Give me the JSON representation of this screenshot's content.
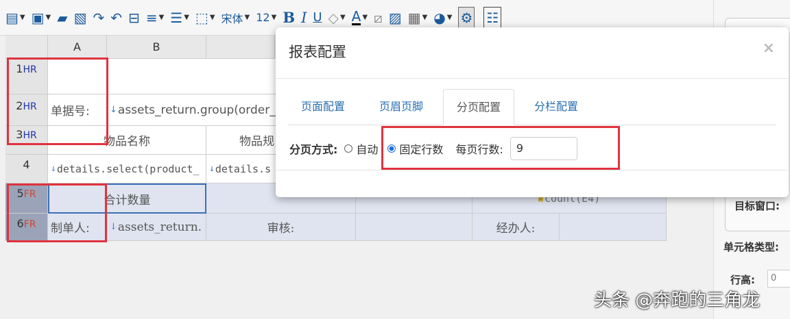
{
  "toolbar": {
    "font_name": "宋体",
    "font_size": "12",
    "bold_label": "B",
    "italic_label": "I",
    "underline_label": "U",
    "font_color_label": "A"
  },
  "sheet": {
    "columns": [
      "A",
      "B"
    ],
    "rows": [
      {
        "num": "1",
        "tag": "HR"
      },
      {
        "num": "2",
        "tag": "HR"
      },
      {
        "num": "3",
        "tag": "HR"
      },
      {
        "num": "4",
        "tag": ""
      },
      {
        "num": "5",
        "tag": "FR"
      },
      {
        "num": "6",
        "tag": "FR"
      }
    ],
    "cells": {
      "r2_label": "单据号:",
      "r2_expr": "assets_return.group(order_",
      "r3_item_name": "物品名称",
      "r3_item_spec": "物品规",
      "r4_a": "details.select(product_",
      "r4_b": "details.s",
      "r5_total": "合计数量",
      "r5_count": "count(E4)",
      "r6_maker": "制单人:",
      "r6_maker_expr": "assets_return.",
      "r6_review": "审核:",
      "r6_handler": "经办人:"
    }
  },
  "right_panel": {
    "target_window_label": "目标窗口:",
    "cell_type_label": "单元格类型:",
    "row_height_label": "行高:",
    "row_height_value": "0"
  },
  "modal": {
    "title": "报表配置",
    "close": "×",
    "tabs": [
      "页面配置",
      "页眉页脚",
      "分页配置",
      "分栏配置"
    ],
    "active_tab": "分页配置",
    "paging_mode_label": "分页方式:",
    "option_auto": "自动",
    "option_fixed": "固定行数",
    "selected_option": "固定行数",
    "rows_per_page_label": "每页行数:",
    "rows_per_page_value": "9"
  },
  "watermark": "头条 @奔跑的三角龙",
  "colors": {
    "accent": "#2a6fb0",
    "highlight_box": "#e0323e",
    "footer_row": "#dfe4f0"
  }
}
